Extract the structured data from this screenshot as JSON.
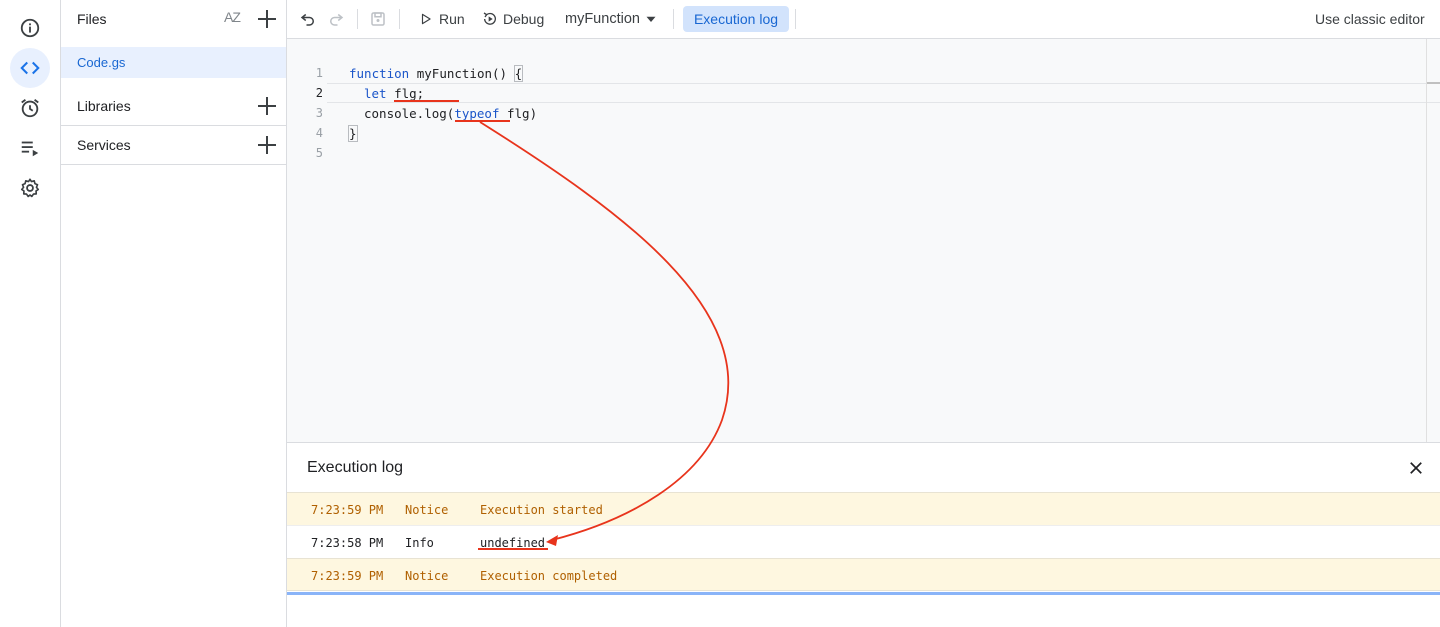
{
  "colors": {
    "accent": "#1a73e8",
    "annotation": "#e8341c",
    "notice_bg": "#fef7e0",
    "notice_text": "#b06000"
  },
  "rail": {
    "items": [
      {
        "icon": "info-icon"
      },
      {
        "icon": "code-icon",
        "active": true
      },
      {
        "icon": "alarm-clock-icon"
      },
      {
        "icon": "executions-icon"
      },
      {
        "icon": "gear-icon"
      }
    ]
  },
  "files_panel": {
    "title": "Files",
    "sort_icon_text": "AZ",
    "files": [
      {
        "name": "Code.gs"
      }
    ],
    "sections": [
      {
        "label": "Libraries"
      },
      {
        "label": "Services"
      }
    ]
  },
  "toolbar": {
    "run_label": "Run",
    "debug_label": "Debug",
    "function_select": "myFunction",
    "execution_log_label": "Execution log",
    "classic_editor_label": "Use classic editor"
  },
  "editor": {
    "line_numbers": [
      "1",
      "2",
      "3",
      "4",
      "5"
    ],
    "lines": {
      "l1_kw": "function",
      "l1_rest": " myFunction() ",
      "l1_brace": "{",
      "l2_kw": "let",
      "l2_rest": " flg;",
      "l3_pre": "console.log(",
      "l3_kw": "typeof",
      "l3_rest": " flg)",
      "l4_brace": "}"
    }
  },
  "execution_log": {
    "title": "Execution log",
    "rows": [
      {
        "time": "7:23:59 PM",
        "level": "Notice",
        "message": "Execution started"
      },
      {
        "time": "7:23:58 PM",
        "level": "Info",
        "message": "undefined"
      },
      {
        "time": "7:23:59 PM",
        "level": "Notice",
        "message": "Execution completed"
      }
    ]
  }
}
